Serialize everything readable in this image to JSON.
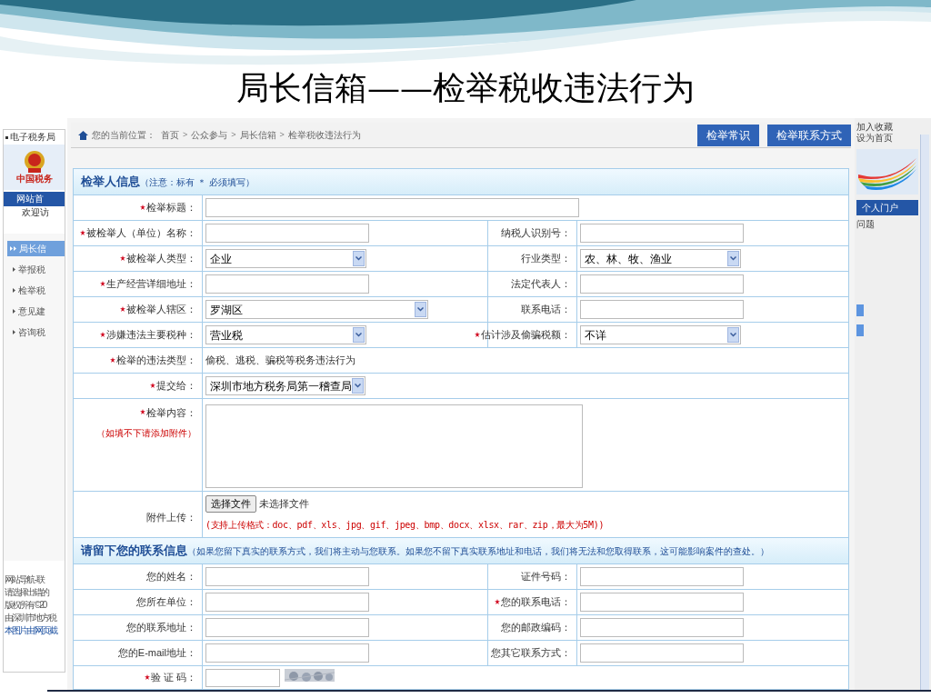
{
  "slide": {
    "title": "局长信箱——检举税收违法行为"
  },
  "left_panel": {
    "top_link": "电子税务局",
    "logo_text": "中国税务",
    "nav_tab": "网站首",
    "welcome": "欢迎访",
    "menu": [
      {
        "label": "局长信",
        "selected": true
      },
      {
        "label": "举报税",
        "selected": false
      },
      {
        "label": "检举税",
        "selected": false
      },
      {
        "label": "意见建",
        "selected": false
      },
      {
        "label": "咨询税",
        "selected": false
      }
    ],
    "footer": [
      {
        "text": "网站导航 - 联",
        "kind": "plain"
      },
      {
        "text": "请选择出错的",
        "kind": "plain"
      },
      {
        "text": "版权所有 ©20",
        "kind": "plain"
      },
      {
        "text": "由深圳市地方税",
        "kind": "plain"
      },
      {
        "text": "本图片由“网页截",
        "kind": "link"
      }
    ]
  },
  "breadcrumb": {
    "label": "您的当前位置：",
    "items": [
      "首页",
      "公众参与",
      "局长信箱",
      "检举税收违法行为"
    ],
    "separator": ">"
  },
  "top_buttons": [
    "检举常识",
    "检举联系方式"
  ],
  "sections": [
    {
      "heading": "检举人信息",
      "note": "（注意：标有 ＊ 必须填写）",
      "rows": [
        [
          {
            "label": "检举标题：",
            "required": true,
            "kind": "text-long"
          }
        ],
        [
          {
            "label": "被检举人（单位）名称：",
            "required": true,
            "kind": "text"
          },
          {
            "label": "纳税人识别号：",
            "required": false,
            "kind": "text"
          }
        ],
        [
          {
            "label": "被检举人类型：",
            "required": true,
            "kind": "select",
            "value": "企业"
          },
          {
            "label": "行业类型：",
            "required": false,
            "kind": "select",
            "value": "农、林、牧、渔业"
          }
        ],
        [
          {
            "label": "生产经营详细地址：",
            "required": true,
            "kind": "text"
          },
          {
            "label": "法定代表人：",
            "required": false,
            "kind": "text"
          }
        ],
        [
          {
            "label": "被检举人辖区：",
            "required": true,
            "kind": "select-wide",
            "value": "罗湖区"
          },
          {
            "label": "联系电话：",
            "required": false,
            "kind": "text"
          }
        ],
        [
          {
            "label": "涉嫌违法主要税种：",
            "required": true,
            "kind": "select",
            "value": "营业税"
          },
          {
            "label": "估计涉及偷骗税额：",
            "required": true,
            "kind": "select",
            "value": "不详"
          }
        ],
        [
          {
            "label": "检举的违法类型：",
            "required": true,
            "kind": "static",
            "value": "偷税、逃税、骗税等税务违法行为"
          }
        ],
        [
          {
            "label": "提交给：",
            "required": true,
            "kind": "select-short",
            "value": "深圳市地方税务局第一稽查局"
          }
        ],
        [
          {
            "label": "检举内容：",
            "required": true,
            "kind": "textarea",
            "hint": "（如填不下请添加附件）"
          }
        ],
        [
          {
            "label": "附件上传：",
            "required": false,
            "kind": "file",
            "button": "选择文件",
            "value": "未选择文件",
            "hint": "(支持上传格式：doc、pdf、xls、jpg、gif、jpeg、bmp、docx、xlsx、rar、zip，最大为5M))"
          }
        ]
      ]
    },
    {
      "heading": "请留下您的联系信息",
      "note": "（如果您留下真实的联系方式，我们将主动与您联系。如果您不留下真实联系地址和电话，我们将无法和您取得联系，这可能影响案件的查处。）",
      "rows": [
        [
          {
            "label": "您的姓名：",
            "required": false,
            "kind": "text"
          },
          {
            "label": "证件号码：",
            "required": false,
            "kind": "text"
          }
        ],
        [
          {
            "label": "您所在单位：",
            "required": false,
            "kind": "text"
          },
          {
            "label": "您的联系电话：",
            "required": true,
            "kind": "text"
          }
        ],
        [
          {
            "label": "您的联系地址：",
            "required": false,
            "kind": "text"
          },
          {
            "label": "您的邮政编码：",
            "required": false,
            "kind": "text"
          }
        ],
        [
          {
            "label": "您的E-mail地址：",
            "required": false,
            "kind": "text"
          },
          {
            "label": "您其它联系方式：",
            "required": false,
            "kind": "text"
          }
        ],
        [
          {
            "label": "验 证 码：",
            "required": true,
            "kind": "captcha"
          }
        ]
      ]
    }
  ],
  "right_panel": {
    "links": [
      "加入收藏",
      "设为首页"
    ],
    "nav_tab": "个人门户",
    "item": "问题"
  }
}
